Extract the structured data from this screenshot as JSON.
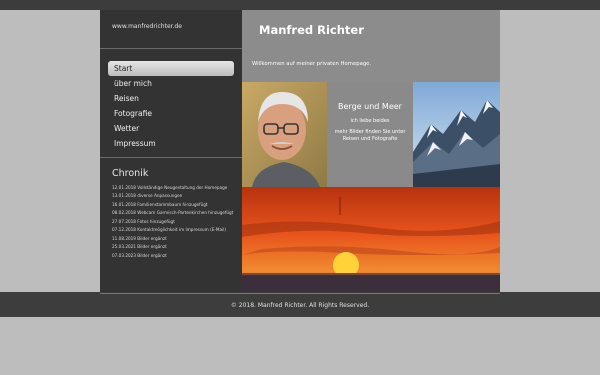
{
  "site": {
    "url": "www.manfredrichter.de",
    "title": "Manfred Richter",
    "welcome": "Willkommen auf meiner privaten Homepage."
  },
  "nav": {
    "items": [
      {
        "label": "Start"
      },
      {
        "label": "über mich"
      },
      {
        "label": "Reisen"
      },
      {
        "label": "Fotografie"
      },
      {
        "label": "Wetter"
      },
      {
        "label": "Impressum"
      }
    ]
  },
  "chronik": {
    "title": "Chronik",
    "entries": [
      "12.01.2018 Vollständige Neugestaltung der Homepage",
      "13.01.2018 diverse Anpassungen",
      "16.01.2018 Familienstammbaum hinzugefügt",
      "08.02.2018 Webcam Garmisch-Partenkirchen hinzugefügt",
      "27.07.2018 Fotos hinzugefügt",
      "07.12.2018 Kontaktmöglichkeit im Impressum (E-Mail)",
      "11.08.2019 Bilder ergänzt",
      "25.03.2021 Bilder ergänzt",
      "07.03.2023 Bilder ergänzt"
    ]
  },
  "quote": {
    "title": "Berge und  Meer",
    "line1": "ich liebe beides",
    "line2": "mehr Bilder finden Sie unter",
    "line3": "Reisen und Fotografie"
  },
  "footer": {
    "copyright": "© 2018. Manfred Richter. All Rights Reserved."
  },
  "colors": {
    "background": "#bdbdbd",
    "sidebar": "#333333",
    "header": "#8c8c8c",
    "sunset_orange": "#e8541c"
  }
}
